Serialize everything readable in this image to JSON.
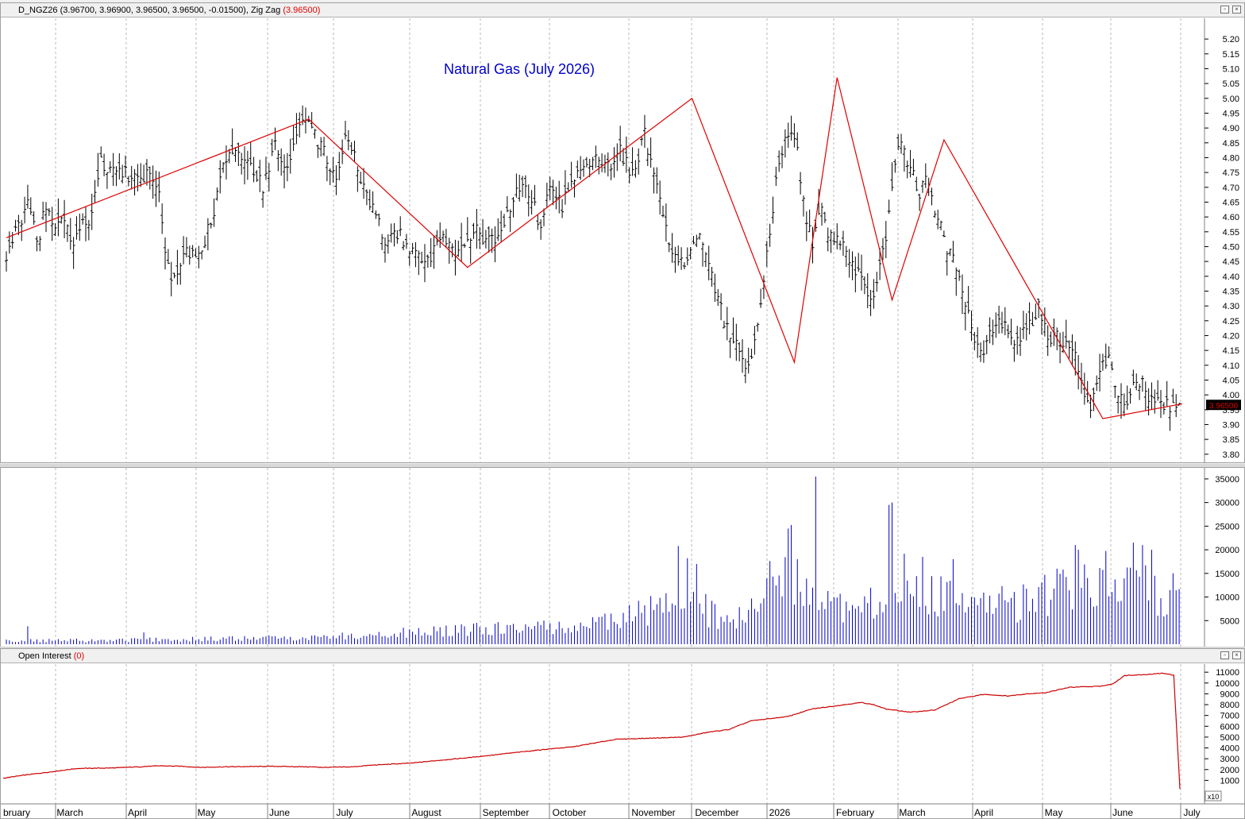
{
  "price_pane": {
    "symbol": "D_NGZ26",
    "ohlc": "(3.96700, 3.96900, 3.96500, 3.96500, -0.01500),",
    "indicator": "Zig Zag",
    "indicator_value": "(3.96500)",
    "title": "Natural Gas (July 2026)",
    "last_price_label": "3.96500"
  },
  "oi_pane": {
    "label": "Open Interest",
    "value": "(0)",
    "scale_note": "x10"
  },
  "colors": {
    "bars": "#000000",
    "zigzag": "#e00000",
    "volume": "#0000cc",
    "open_interest": "#cc0000",
    "title": "#0000cc",
    "grid": "#b8b8b8"
  },
  "icons": [
    "restore-icon",
    "close-icon"
  ],
  "chart_data": [
    {
      "type": "ohlc",
      "title": "Natural Gas (July 2026)",
      "ylim": [
        3.77,
        5.27
      ],
      "y_ticks": [
        "5.20",
        "5.15",
        "5.10",
        "5.05",
        "5.00",
        "4.95",
        "4.90",
        "4.85",
        "4.80",
        "4.75",
        "4.70",
        "4.65",
        "4.60",
        "4.55",
        "4.50",
        "4.45",
        "4.40",
        "4.35",
        "4.30",
        "4.25",
        "4.20",
        "4.15",
        "4.10",
        "4.05",
        "4.00",
        "3.95",
        "3.90",
        "3.85",
        "3.80"
      ],
      "months": [
        "bruary",
        "March",
        "April",
        "May",
        "June",
        "July",
        "August",
        "September",
        "October",
        "November",
        "December",
        "2026",
        "February",
        "March",
        "April",
        "May",
        "June",
        "July"
      ],
      "close_anchors": [
        [
          0,
          4.47
        ],
        [
          8,
          4.58
        ],
        [
          15,
          4.65
        ],
        [
          20,
          4.5
        ],
        [
          25,
          4.62
        ],
        [
          32,
          4.57
        ],
        [
          38,
          4.6
        ],
        [
          43,
          4.49
        ],
        [
          48,
          4.56
        ],
        [
          55,
          4.6
        ],
        [
          62,
          4.78
        ],
        [
          75,
          4.75
        ],
        [
          85,
          4.73
        ],
        [
          95,
          4.74
        ],
        [
          100,
          4.68
        ],
        [
          105,
          4.45
        ],
        [
          110,
          4.38
        ],
        [
          118,
          4.48
        ],
        [
          125,
          4.45
        ],
        [
          135,
          4.6
        ],
        [
          142,
          4.8
        ],
        [
          150,
          4.83
        ],
        [
          160,
          4.78
        ],
        [
          168,
          4.7
        ],
        [
          176,
          4.84
        ],
        [
          185,
          4.75
        ],
        [
          190,
          4.9
        ],
        [
          198,
          4.92
        ],
        [
          203,
          4.86
        ],
        [
          210,
          4.8
        ],
        [
          217,
          4.72
        ],
        [
          222,
          4.85
        ],
        [
          228,
          4.82
        ],
        [
          232,
          4.72
        ],
        [
          240,
          4.62
        ],
        [
          248,
          4.52
        ],
        [
          255,
          4.56
        ],
        [
          262,
          4.5
        ],
        [
          270,
          4.48
        ],
        [
          276,
          4.45
        ],
        [
          282,
          4.52
        ],
        [
          288,
          4.52
        ],
        [
          294,
          4.48
        ],
        [
          300,
          4.5
        ],
        [
          308,
          4.55
        ],
        [
          315,
          4.51
        ],
        [
          322,
          4.54
        ],
        [
          330,
          4.63
        ],
        [
          337,
          4.72
        ],
        [
          344,
          4.66
        ],
        [
          350,
          4.56
        ],
        [
          356,
          4.71
        ],
        [
          364,
          4.64
        ],
        [
          372,
          4.72
        ],
        [
          380,
          4.77
        ],
        [
          388,
          4.8
        ],
        [
          396,
          4.75
        ],
        [
          402,
          4.83
        ],
        [
          408,
          4.75
        ],
        [
          414,
          4.8
        ],
        [
          418,
          4.88
        ],
        [
          424,
          4.74
        ],
        [
          430,
          4.6
        ],
        [
          436,
          4.47
        ],
        [
          442,
          4.44
        ],
        [
          448,
          4.47
        ],
        [
          453,
          4.56
        ],
        [
          460,
          4.45
        ],
        [
          466,
          4.32
        ],
        [
          472,
          4.22
        ],
        [
          478,
          4.18
        ],
        [
          482,
          4.1
        ],
        [
          487,
          4.12
        ],
        [
          492,
          4.25
        ],
        [
          496,
          4.4
        ],
        [
          500,
          4.55
        ],
        [
          505,
          4.75
        ],
        [
          510,
          4.85
        ],
        [
          514,
          4.87
        ],
        [
          518,
          4.82
        ],
        [
          523,
          4.6
        ],
        [
          528,
          4.52
        ],
        [
          533,
          4.66
        ],
        [
          538,
          4.55
        ],
        [
          544,
          4.52
        ],
        [
          550,
          4.48
        ],
        [
          556,
          4.42
        ],
        [
          562,
          4.36
        ],
        [
          566,
          4.34
        ],
        [
          570,
          4.37
        ],
        [
          574,
          4.48
        ],
        [
          578,
          4.6
        ],
        [
          582,
          4.8
        ],
        [
          586,
          4.85
        ],
        [
          590,
          4.78
        ],
        [
          594,
          4.75
        ],
        [
          598,
          4.68
        ],
        [
          602,
          4.72
        ],
        [
          606,
          4.65
        ],
        [
          610,
          4.6
        ],
        [
          616,
          4.5
        ],
        [
          622,
          4.42
        ],
        [
          628,
          4.3
        ],
        [
          634,
          4.2
        ],
        [
          640,
          4.16
        ],
        [
          646,
          4.22
        ],
        [
          652,
          4.25
        ],
        [
          658,
          4.18
        ],
        [
          664,
          4.2
        ],
        [
          670,
          4.23
        ],
        [
          676,
          4.3
        ],
        [
          682,
          4.18
        ],
        [
          688,
          4.2
        ],
        [
          694,
          4.16
        ],
        [
          700,
          4.12
        ],
        [
          706,
          4.0
        ],
        [
          710,
          3.95
        ],
        [
          714,
          4.05
        ],
        [
          718,
          4.1
        ],
        [
          722,
          4.12
        ],
        [
          726,
          4.05
        ],
        [
          730,
          3.98
        ],
        [
          734,
          3.95
        ],
        [
          738,
          4.02
        ],
        [
          742,
          4.05
        ],
        [
          746,
          4.02
        ],
        [
          750,
          3.97
        ]
      ],
      "zigzag": [
        [
          0,
          4.53
        ],
        [
          198,
          4.93
        ],
        [
          302,
          4.43
        ],
        [
          449,
          5.0
        ],
        [
          516,
          4.11
        ],
        [
          544,
          5.07
        ],
        [
          580,
          4.32
        ],
        [
          614,
          4.86
        ],
        [
          718,
          3.92
        ],
        [
          770,
          3.97
        ]
      ]
    },
    {
      "type": "bar",
      "ylabel": "",
      "ylim": [
        0,
        37000
      ],
      "y_ticks": [
        "35000",
        "30000",
        "25000",
        "20000",
        "15000",
        "10000",
        "5000"
      ],
      "volume_anchors": [
        [
          0,
          800
        ],
        [
          60,
          900
        ],
        [
          100,
          1100
        ],
        [
          150,
          1300
        ],
        [
          200,
          1600
        ],
        [
          230,
          2100
        ],
        [
          260,
          2600
        ],
        [
          290,
          3100
        ],
        [
          330,
          3800
        ],
        [
          370,
          4200
        ],
        [
          400,
          5500
        ],
        [
          420,
          7500
        ],
        [
          432,
          11000
        ],
        [
          445,
          14000
        ],
        [
          455,
          9000
        ],
        [
          470,
          5000
        ],
        [
          490,
          8000
        ],
        [
          505,
          16000
        ],
        [
          515,
          19000
        ],
        [
          530,
          12000
        ],
        [
          545,
          8000
        ],
        [
          560,
          7500
        ],
        [
          575,
          11000
        ],
        [
          585,
          18000
        ],
        [
          598,
          15000
        ],
        [
          610,
          11000
        ],
        [
          630,
          9000
        ],
        [
          660,
          9500
        ],
        [
          690,
          12000
        ],
        [
          710,
          16000
        ],
        [
          730,
          15000
        ],
        [
          750,
          13000
        ],
        [
          770,
          13000
        ]
      ],
      "volume_spikes": [
        [
          3,
          1200
        ],
        [
          14,
          3800
        ],
        [
          33,
          2700
        ],
        [
          90,
          2500
        ],
        [
          225,
          3800
        ],
        [
          255,
          3500
        ],
        [
          300,
          3800
        ],
        [
          440,
          20800
        ],
        [
          447,
          17500
        ],
        [
          452,
          17000
        ],
        [
          512,
          24500
        ],
        [
          518,
          18000
        ],
        [
          527,
          22000
        ],
        [
          530,
          35500
        ],
        [
          573,
          24000
        ],
        [
          578,
          29500
        ],
        [
          580,
          30000
        ],
        [
          593,
          30500
        ],
        [
          600,
          18500
        ],
        [
          620,
          18000
        ],
        [
          643,
          16000
        ],
        [
          688,
          16000
        ],
        [
          695,
          23000
        ],
        [
          700,
          21000
        ],
        [
          702,
          20000
        ],
        [
          713,
          19500
        ],
        [
          717,
          29000
        ],
        [
          721,
          19000
        ],
        [
          738,
          21500
        ],
        [
          744,
          21000
        ],
        [
          750,
          20000
        ]
      ]
    },
    {
      "type": "line",
      "ylabel": "",
      "ylim": [
        0,
        11600
      ],
      "y_ticks": [
        "11000",
        "10000",
        "9000",
        "8000",
        "7000",
        "6000",
        "5000",
        "4000",
        "3000",
        "2000",
        "1000"
      ],
      "scale_note": "x10",
      "oi_anchors": [
        [
          0,
          1200
        ],
        [
          18,
          1500
        ],
        [
          40,
          1800
        ],
        [
          60,
          2100
        ],
        [
          90,
          2150
        ],
        [
          110,
          2250
        ],
        [
          128,
          2350
        ],
        [
          146,
          2300
        ],
        [
          160,
          2200
        ],
        [
          180,
          2250
        ],
        [
          220,
          2300
        ],
        [
          250,
          2250
        ],
        [
          262,
          2200
        ],
        [
          285,
          2250
        ],
        [
          300,
          2400
        ],
        [
          333,
          2600
        ],
        [
          360,
          2900
        ],
        [
          380,
          3100
        ],
        [
          420,
          3600
        ],
        [
          445,
          3900
        ],
        [
          465,
          4100
        ],
        [
          500,
          4800
        ],
        [
          555,
          5000
        ],
        [
          575,
          5450
        ],
        [
          592,
          5700
        ],
        [
          610,
          6500
        ],
        [
          640,
          6900
        ],
        [
          660,
          7600
        ],
        [
          700,
          8200
        ],
        [
          710,
          8000
        ],
        [
          720,
          7600
        ],
        [
          740,
          7300
        ],
        [
          760,
          7500
        ],
        [
          780,
          8550
        ],
        [
          800,
          8950
        ],
        [
          820,
          8800
        ],
        [
          835,
          9000
        ],
        [
          850,
          9100
        ],
        [
          870,
          9600
        ],
        [
          895,
          9700
        ],
        [
          905,
          9900
        ],
        [
          915,
          10700
        ],
        [
          935,
          10800
        ],
        [
          945,
          10900
        ],
        [
          950,
          10850
        ],
        [
          955,
          10700
        ],
        [
          960,
          200
        ]
      ]
    }
  ]
}
